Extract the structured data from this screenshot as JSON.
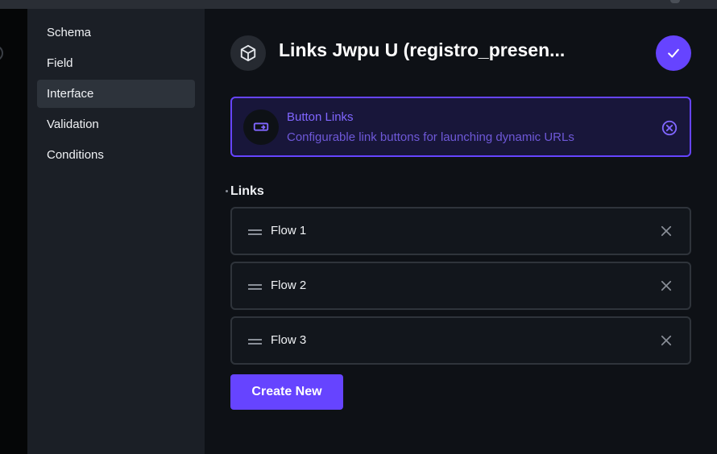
{
  "nav": {
    "items": [
      {
        "label": "Schema"
      },
      {
        "label": "Field"
      },
      {
        "label": "Interface"
      },
      {
        "label": "Validation"
      },
      {
        "label": "Conditions"
      }
    ],
    "active": "Interface"
  },
  "header": {
    "title": "Links Jwpu U (registro_presen...",
    "icon": "cube-icon",
    "confirm_icon": "check-icon"
  },
  "interface": {
    "name": "Button Links",
    "description": "Configurable link buttons for launching dynamic URLs",
    "icon": "smart-button-icon",
    "clear_icon": "close-circle-icon"
  },
  "links_field": {
    "label": "Links",
    "required": true,
    "items": [
      {
        "label": "Flow 1"
      },
      {
        "label": "Flow 2"
      },
      {
        "label": "Flow 3"
      }
    ],
    "create_label": "Create New"
  },
  "colors": {
    "accent": "#6644ff",
    "nav_bg": "#1b1f26",
    "main_bg": "#0e1116",
    "active_bg": "#2d333b"
  }
}
